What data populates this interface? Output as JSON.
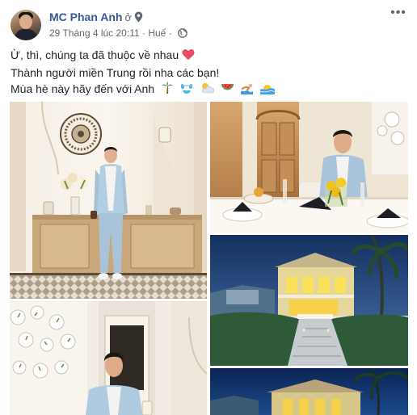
{
  "post": {
    "author": "MC Phan Anh",
    "location_prefix": "ở",
    "date": "29 Tháng 4 lúc 20:11",
    "separator": "·",
    "place": "Huế",
    "more_icon": "more-dots-icon",
    "caption_lines": [
      "Ừ, thì, chúng ta đã thuộc về nhau",
      "Thành người miền Trung rồi nha các bạn!",
      "Mùa hè này hãy đến với Anh"
    ],
    "emojis": [
      "heart",
      "palm-tree",
      "bikini",
      "sun-cloud",
      "watermelon",
      "swimmer",
      "sunrise-wave"
    ]
  },
  "colors": {
    "author": "#385898",
    "meta": "#606770",
    "text": "#1d2129"
  }
}
